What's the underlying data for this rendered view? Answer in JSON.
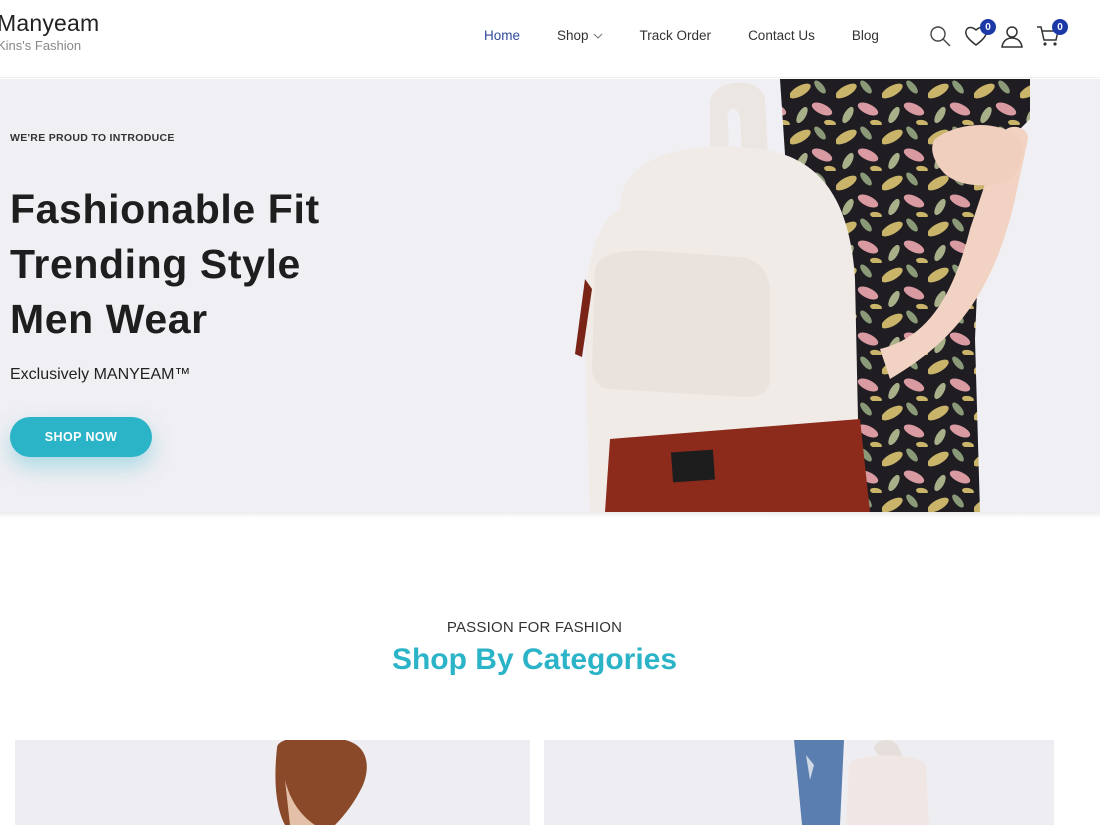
{
  "brand": {
    "name": "Manyeam",
    "tagline": "Kins's Fashion"
  },
  "nav": {
    "items": [
      {
        "label": "Home",
        "active": true
      },
      {
        "label": "Shop",
        "has_dropdown": true
      },
      {
        "label": "Track Order"
      },
      {
        "label": "Contact Us"
      },
      {
        "label": "Blog"
      }
    ]
  },
  "header_icons": {
    "search": "search-icon",
    "wishlist": {
      "icon": "heart-icon",
      "count": "0"
    },
    "account": "user-icon",
    "cart": {
      "icon": "cart-icon",
      "count": "0"
    }
  },
  "hero": {
    "eyebrow": "WE'RE PROUD TO INTRODUCE",
    "title_lines": [
      "Fashionable Fit",
      "Trending Style",
      "Men Wear"
    ],
    "subtitle": "Exclusively MANYEAM™",
    "cta_label": "SHOP NOW"
  },
  "categories": {
    "eyebrow": "PASSION FOR FASHION",
    "title": "Shop By Categories"
  },
  "colors": {
    "accent": "#2bb3c8",
    "nav_active": "#2d4a9c",
    "badge": "#1b3aa8",
    "hero_bg": "#f0eff3"
  }
}
